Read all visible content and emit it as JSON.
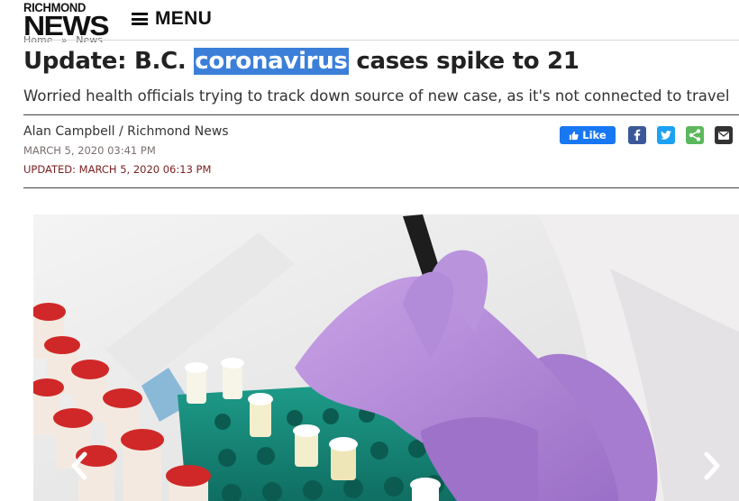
{
  "header": {
    "logo_line1": "RICHMOND",
    "logo_line2": "NEWS",
    "menu_label": "MENU"
  },
  "breadcrumb": {
    "home": "Home",
    "sep": "»",
    "section": "News"
  },
  "article": {
    "title_before": "Update: B.C. ",
    "title_highlight": "coronavirus",
    "title_after": " cases spike to 21",
    "subtitle": "Worried health officials trying to track down source of new case, as it's not connected to travel",
    "author": "Alan Campbell / Richmond News",
    "published": "MARCH 5, 2020 03:41 PM",
    "updated": "UPDATED: MARCH 5, 2020 06:13 PM"
  },
  "share": {
    "like_label": "Like",
    "icons": [
      "facebook-icon",
      "twitter-icon",
      "share-icon",
      "email-icon"
    ]
  },
  "colors": {
    "highlight": "#3b7fd9",
    "facebook": "#1877f2",
    "twitter": "#1da1f2",
    "share_green": "#5cb85c",
    "updated_red": "#7a1f1f"
  },
  "image": {
    "description_icon": "lab-photo"
  }
}
